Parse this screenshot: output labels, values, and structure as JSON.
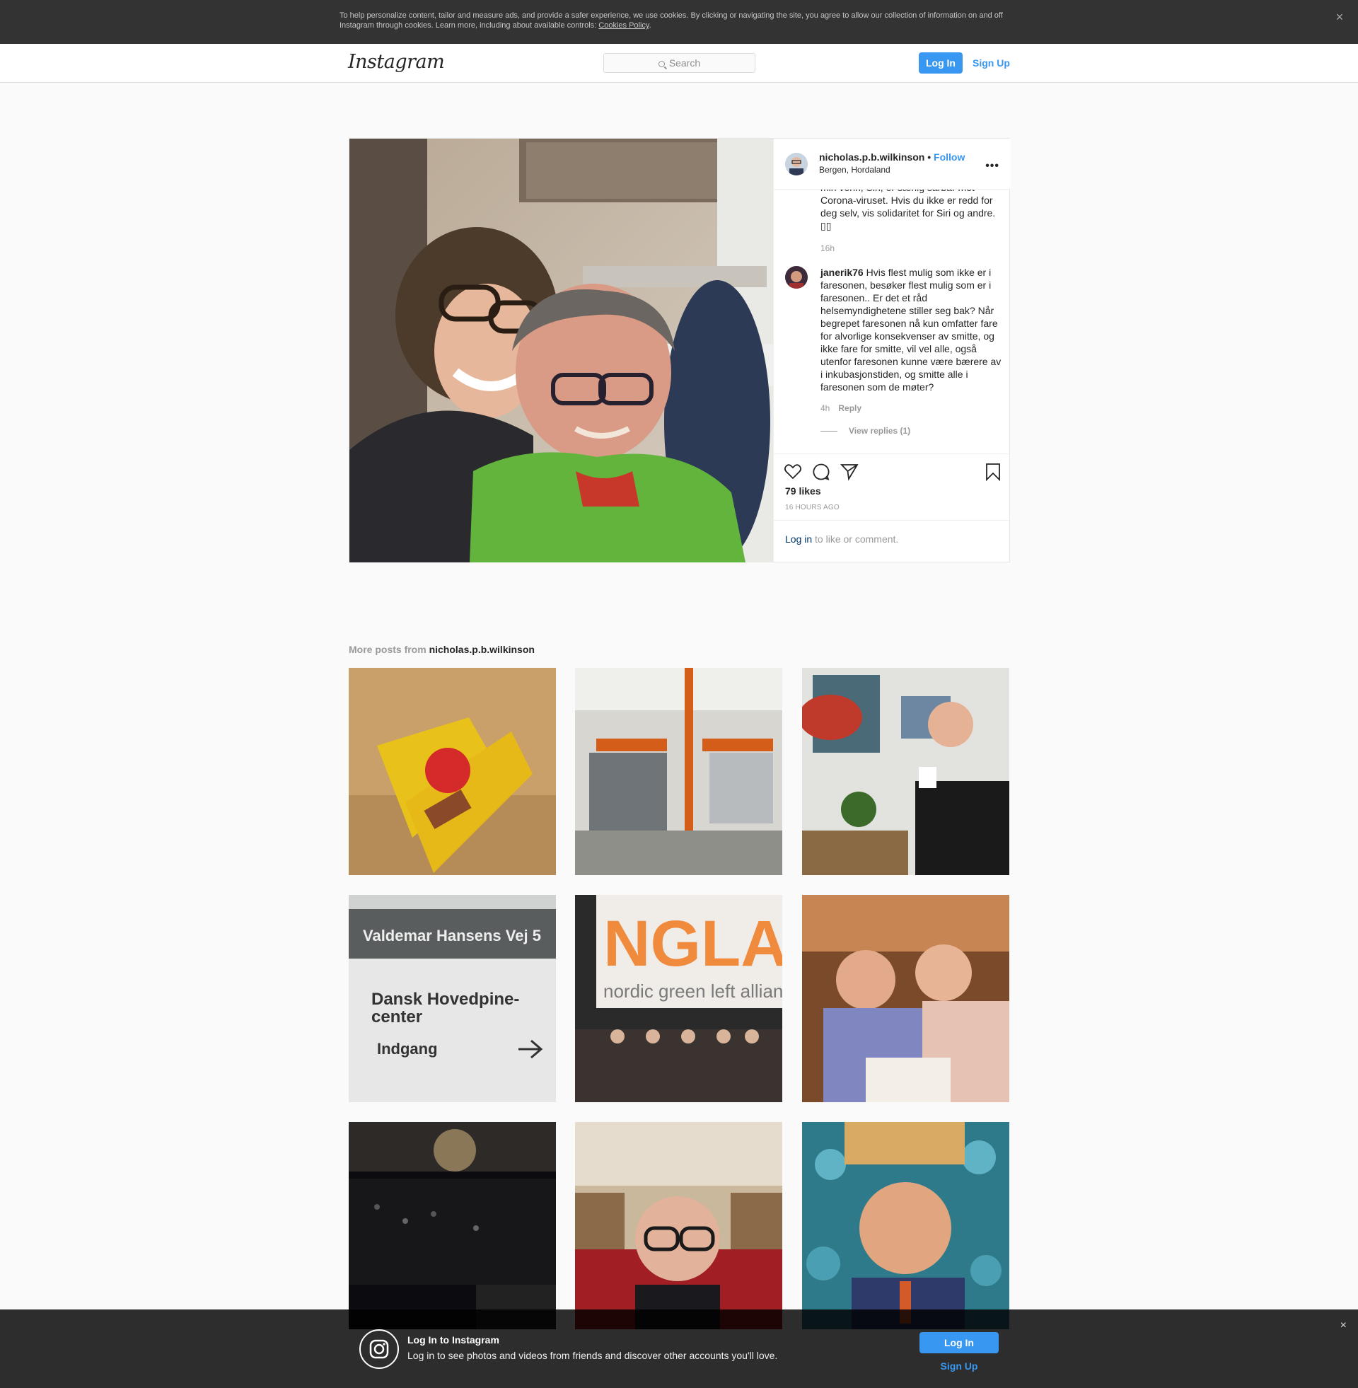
{
  "cookie_bar": {
    "text": "To help personalize content, tailor and measure ads, and provide a safer experience, we use cookies. By clicking or navigating the site, you agree to allow our collection of information on and off Instagram through cookies. Learn more, including about available controls: ",
    "link": "Cookies Policy",
    "end": ".",
    "close": "×"
  },
  "header": {
    "logo": "Instagram",
    "search_placeholder": "Search",
    "login": "Log In",
    "signup": "Sign Up"
  },
  "post": {
    "username": "nicholas.p.b.wilkinson",
    "separator": " • ",
    "follow": "Follow",
    "location": "Bergen, Hordaland",
    "more": "•••",
    "caption_partial": "min venn, Siri, er særlig sårbar mot Corona-viruset. Hvis du ikke er redd for deg selv, vis solidaritet for Siri og andre. ▯▯",
    "caption_time": "16h",
    "comments": [
      {
        "username": "janerik76",
        "text": "Hvis flest mulig som ikke er i faresonen, besøker flest mulig som er i faresonen.. Er det et råd helsemyndighetene stiller seg bak? Når begrepet faresonen nå kun omfatter fare for alvorlige konsekvenser av smitte, og ikke fare for smitte, vil vel alle, også utenfor faresonen kunne være bærere av i inkubasjonstiden, og smitte alle i faresonen som de møter?",
        "time": "4h",
        "reply": "Reply",
        "view_replies": "View replies (1)"
      }
    ],
    "likes": "79 likes",
    "time_ago": "16 HOURS AGO",
    "login_link": "Log in",
    "login_rest": " to like or comment."
  },
  "more_posts": {
    "prefix": "More posts from ",
    "username": "nicholas.p.b.wilkinson"
  },
  "bottom_bar": {
    "title": "Log In to Instagram",
    "text": "Log in to see photos and videos from friends and discover other accounts you'll love.",
    "login": "Log In",
    "signup": "Sign Up",
    "close": "×"
  }
}
